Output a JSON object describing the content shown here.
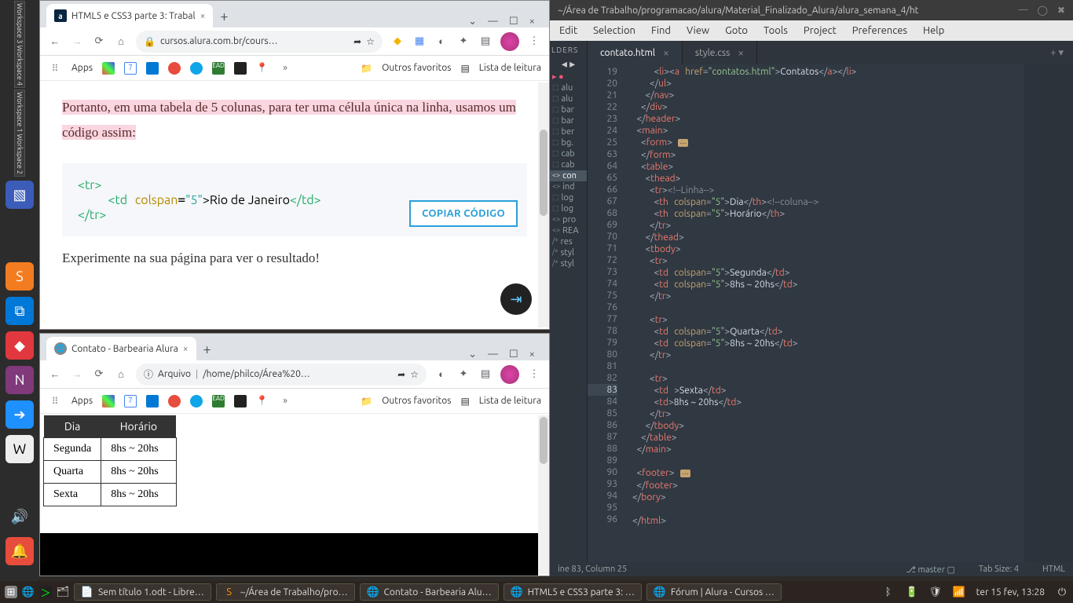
{
  "ubuntu": {
    "workspaces": [
      "Workspace 3 Workspace 4",
      "Workspace 1 Workspace 2"
    ]
  },
  "chrome1": {
    "tab_title": "HTML5 e CSS3 parte 3: Trabal",
    "url": "cursos.alura.com.br/cours…",
    "apps_label": "Apps",
    "other_bookmarks": "Outros favoritos",
    "reading_list": "Lista de leitura",
    "highlight_text": "Portanto, em uma tabela de 5 colunas, para ter uma célula única na linha, usamos um código assim:",
    "code_line1_a": "<tr>",
    "code_line2_a": "<td",
    "code_line2_b": "colspan",
    "code_line2_c": "\"5\"",
    "code_line2_d": ">Rio de Janeiro",
    "code_line2_e": "</td>",
    "code_line3_a": "</tr>",
    "copy_btn": "COPIAR CÓDIGO",
    "after_text": "Experimente na sua página para ver o resultado!"
  },
  "chrome2": {
    "tab_title": "Contato - Barbearia Alura",
    "url_prefix": "Arquivo",
    "url": "/home/philco/Área%20…",
    "apps_label": "Apps",
    "other_bookmarks": "Outros favoritos",
    "reading_list": "Lista de leitura",
    "th1": "Dia",
    "th2": "Horário",
    "r1c1": "Segunda",
    "r1c2": "8hs ~ 20hs",
    "r2c1": "Quarta",
    "r2c2": "8hs ~ 20hs",
    "r3c1": "Sexta",
    "r3c2": "8hs ~ 20hs"
  },
  "sublime": {
    "title": "~/Área de Trabalho/programacao/alura/Material_Finalizado_Alura/alura_semana_4/ht",
    "menu": [
      "Edit",
      "Selection",
      "Find",
      "View",
      "Goto",
      "Tools",
      "Project",
      "Preferences",
      "Help"
    ],
    "sidebar_header": "LDERS",
    "sidebar_files": [
      "alu",
      "alu",
      "bar",
      "bar",
      "ber",
      "bg.",
      "cab",
      "cab",
      "con",
      "ind",
      "log",
      "log",
      "pro",
      "REA",
      "res",
      "styl",
      "styl"
    ],
    "sidebar_sel_index": 8,
    "tab_active": "contato.html",
    "tab_other": "style.css",
    "status_left": "ine 83, Column 25",
    "status_branch": "master",
    "status_tab": "Tab Size: 4",
    "status_lang": "HTML",
    "line_numbers": [
      "19",
      "20",
      "21",
      "22",
      "23",
      "24",
      "25",
      "63",
      "64",
      "65",
      "66",
      "67",
      "68",
      "69",
      "70",
      "71",
      "72",
      "73",
      "74",
      "75",
      "76",
      "77",
      "78",
      "79",
      "80",
      "81",
      "82",
      "83",
      "84",
      "85",
      "86",
      "87",
      "88",
      "89",
      "90",
      "93",
      "94",
      "95",
      "96"
    ],
    "cur_line": "83"
  },
  "taskbar": {
    "items": [
      "Sem título 1.odt - Libre…",
      "~/Área de Trabalho/pro…",
      "Contato - Barbearia Alu…",
      "HTML5 e CSS3 parte 3: …",
      "Fórum | Alura - Cursos …"
    ],
    "clock": "ter 15 fev, 13:28"
  }
}
